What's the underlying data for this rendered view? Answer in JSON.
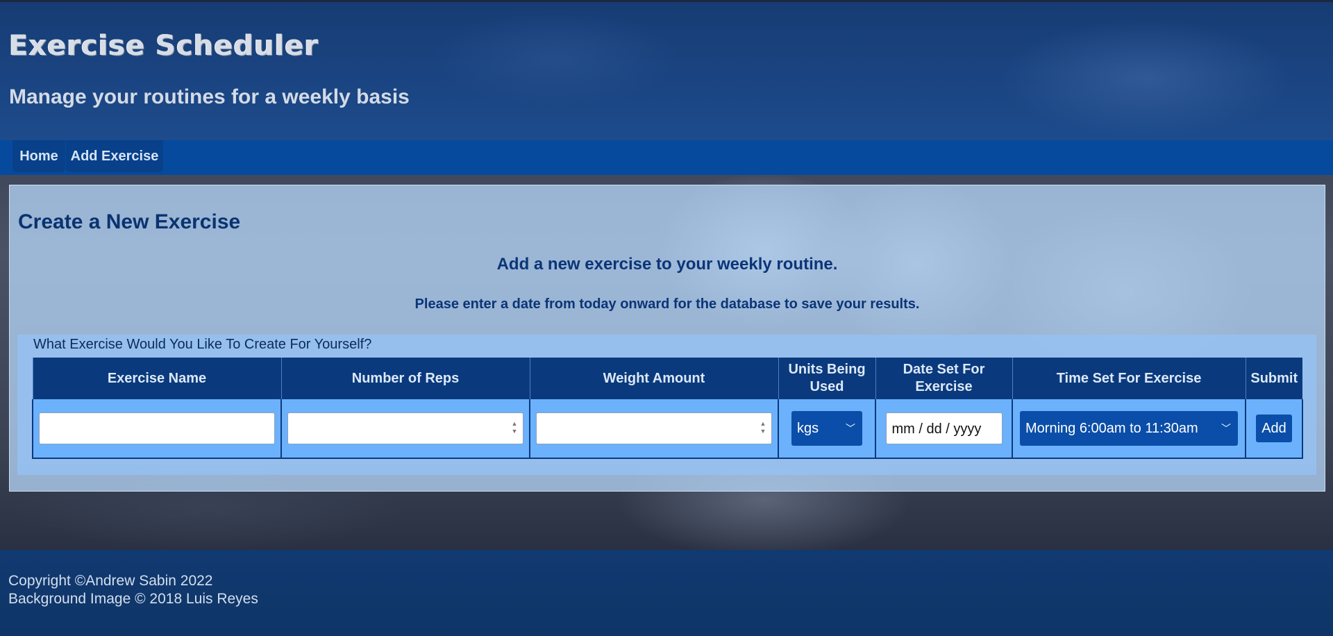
{
  "header": {
    "title": "Exercise Scheduler",
    "subtitle": "Manage your routines for a weekly basis"
  },
  "nav": {
    "items": [
      {
        "label": "Home"
      },
      {
        "label": "Add Exercise"
      }
    ]
  },
  "main": {
    "title": "Create a New Exercise",
    "intro": "Add a new exercise to your weekly routine.",
    "note": "Please enter a date from today onward for the database to save your results.",
    "form": {
      "legend": "What Exercise Would You Like To Create For Yourself?",
      "columns": [
        "Exercise Name",
        "Number of Reps",
        "Weight Amount",
        "Units Being Used",
        "Date Set For Exercise",
        "Time Set For Exercise",
        "Submit"
      ],
      "exercise_name_value": "",
      "reps_value": "",
      "weight_value": "",
      "units_selected": "kgs",
      "date_placeholder": "mm / dd / yyyy",
      "time_selected": "Morning 6:00am to 11:30am",
      "submit_label": "Add"
    }
  },
  "footer": {
    "copyright": "Copyright ©Andrew Sabin 2022",
    "background_credit": "Background Image © 2018 Luis Reyes"
  },
  "colors": {
    "header_bg": "#1d4b8c",
    "nav_bg": "#064a9e",
    "table_header_bg": "#0a3a7d",
    "table_cell_bg": "#6cb1fc",
    "control_bg": "#0a4ea9"
  }
}
